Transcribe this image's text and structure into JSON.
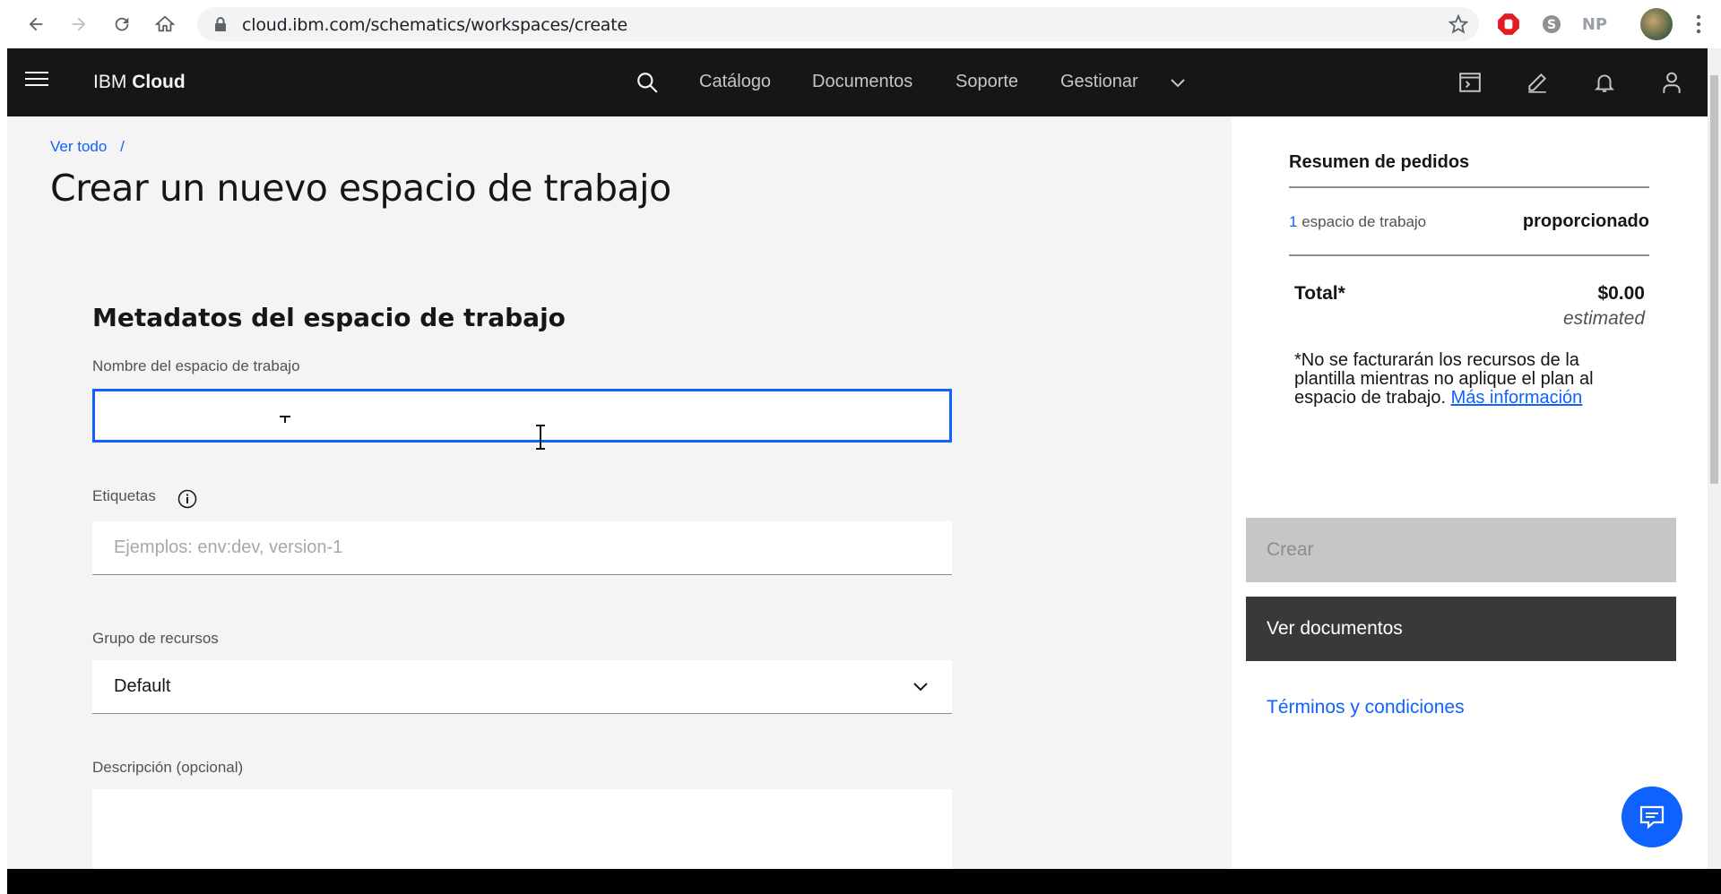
{
  "browser": {
    "url": "cloud.ibm.com/schematics/workspaces/create",
    "ext_np": "NP"
  },
  "header": {
    "brand_prefix": "IBM",
    "brand_suffix": "Cloud",
    "nav": [
      "Catálogo",
      "Documentos",
      "Soporte",
      "Gestionar"
    ]
  },
  "breadcrumb": {
    "link": "Ver todo",
    "separator": "/"
  },
  "page": {
    "title": "Crear un nuevo espacio de trabajo"
  },
  "form": {
    "section_title": "Metadatos del espacio de trabajo",
    "name_label": "Nombre del espacio de trabajo",
    "name_value": "",
    "tags_label": "Etiquetas",
    "tags_placeholder": "Ejemplos: env:dev, version-1",
    "resource_group_label": "Grupo de recursos",
    "resource_group_value": "Default",
    "description_label": "Descripción (opcional)"
  },
  "summary": {
    "title": "Resumen de pedidos",
    "row_count": "1",
    "row_label": "espacio de trabajo",
    "row_value": "proporcionado",
    "total_label": "Total*",
    "total_value": "$0.00",
    "estimated": "estimated",
    "note": "*No se facturarán los recursos de la plantilla mientras no aplique el plan al espacio de trabajo.",
    "note_link": "Más información",
    "create_button": "Crear",
    "docs_button": "Ver documentos",
    "terms": "Términos y condiciones"
  },
  "colors": {
    "accent": "#0f62fe",
    "header_bg": "#161616",
    "content_bg": "#f4f4f4"
  }
}
